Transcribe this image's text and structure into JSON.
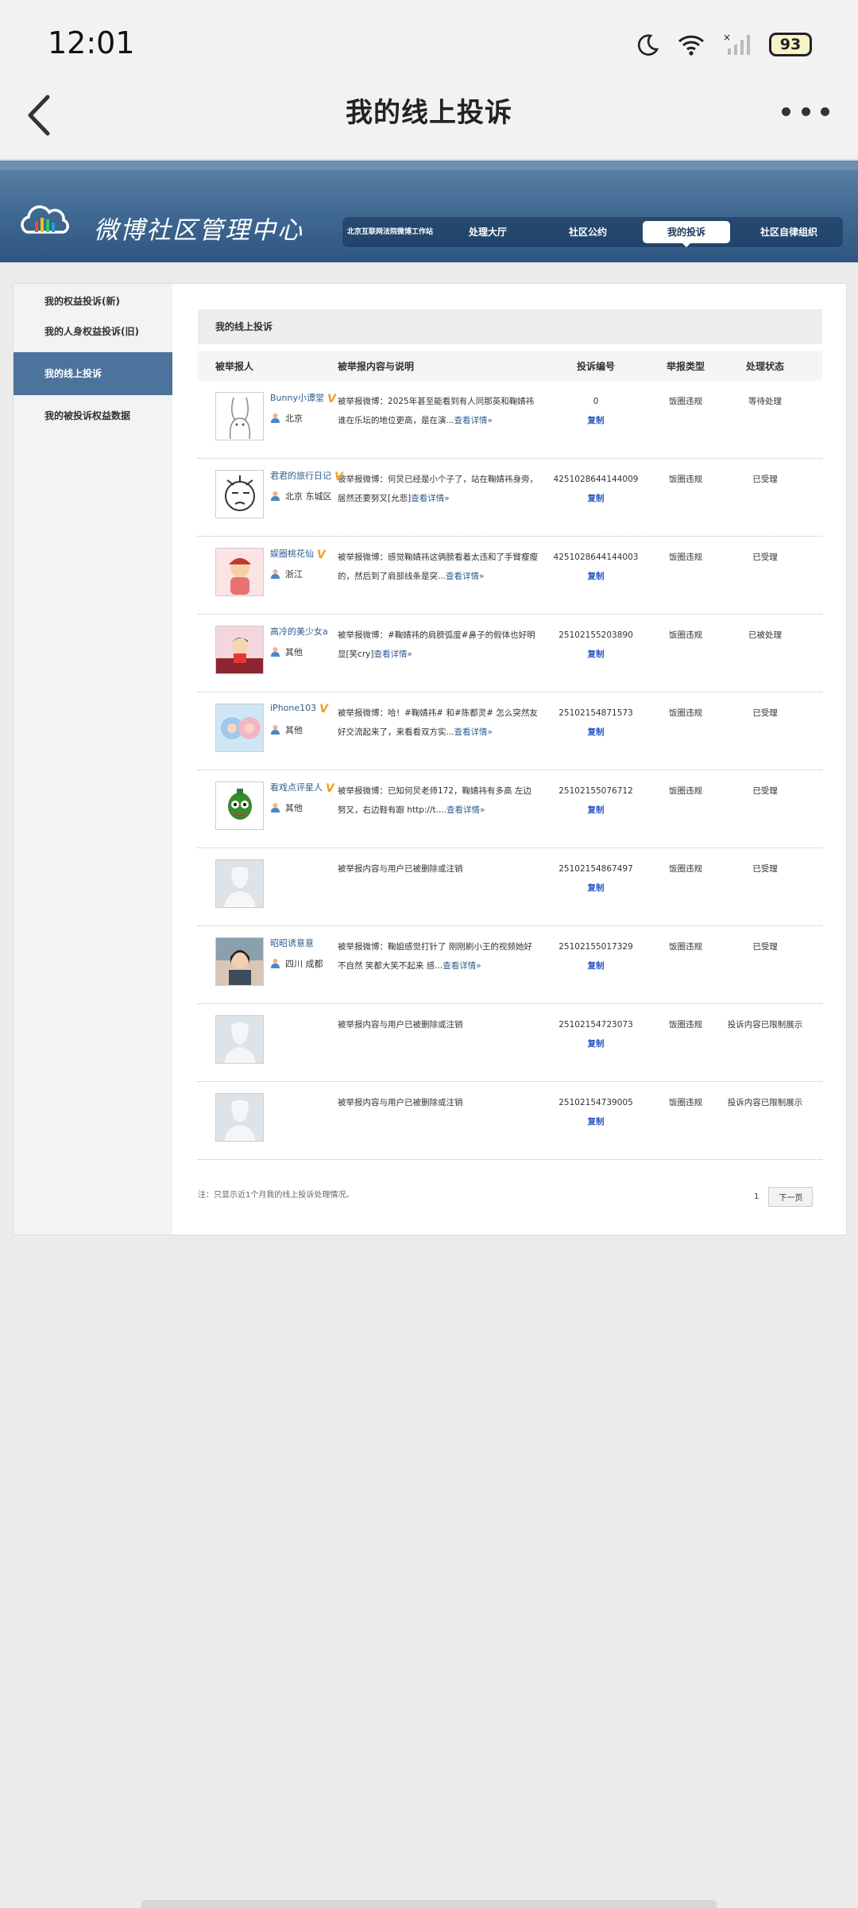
{
  "status_bar": {
    "time": "12:01",
    "battery": "93"
  },
  "nav": {
    "title": "我的线上投诉"
  },
  "header": {
    "logo_text": "微博社区管理中心",
    "nav_items": [
      {
        "label": "北京互联网法院微博工作站"
      },
      {
        "label": "处理大厅"
      },
      {
        "label": "社区公约"
      },
      {
        "label": "我的投诉"
      },
      {
        "label": "社区自律组织"
      }
    ]
  },
  "sidebar": {
    "items": [
      {
        "label": "我的权益投诉(新)"
      },
      {
        "label": "我的人身权益投诉(旧)"
      },
      {
        "label": "我的线上投诉"
      },
      {
        "label": "我的被投诉权益数据"
      }
    ]
  },
  "content": {
    "title": "我的线上投诉",
    "columns": [
      "被举报人",
      "被举报内容与说明",
      "投诉编号",
      "举报类型",
      "处理状态"
    ],
    "copy_label": "复制",
    "rows": [
      {
        "user": "Bunny小谭堂",
        "verified": true,
        "location": "北京",
        "desc": "被举报微博：2025年甚至能看到有人同那英和鞠婧祎谁在乐坛的地位更高，是在演...",
        "more": "查看详情»",
        "id": "0",
        "type": "饭圈违规",
        "status": "等待处理"
      },
      {
        "user": "君君的旅行日记",
        "verified": true,
        "location": "北京 东城区",
        "desc": "被举报微博：何炅已经是小个子了，站在鞠婧祎身旁，居然还要努叉[允悲]",
        "more": "查看详情»",
        "id": "4251028644144009",
        "type": "饭圈违规",
        "status": "已受理"
      },
      {
        "user": "娱圈桃花仙",
        "verified": true,
        "location": "浙江",
        "desc": "被举报微博：感觉鞠婧祎这俩膀看着太违和了手臂瘦瘦的，然后到了肩部线条是突...",
        "more": "查看详情»",
        "id": "4251028644144003",
        "type": "饭圈违规",
        "status": "已受理"
      },
      {
        "user": "高冷的美少女a",
        "verified": false,
        "location": "其他",
        "desc": "被举报微博：#鞠婧祎的肩膀弧度#鼻子的假体也好明显[笑cry]",
        "more": "查看详情»",
        "id": "2510215520389​0",
        "type": "饭圈违规",
        "status": "已被处理"
      },
      {
        "user": "iPhone103",
        "verified": true,
        "location": "其他",
        "desc": "被举报微博：哈！#鞠婧祎# 和#陈都灵# 怎么突然友好交流起来了，来看看双方实...",
        "more": "查看详情»",
        "id": "25102154871573",
        "type": "饭圈违规",
        "status": "已受理"
      },
      {
        "user": "看戏点评星人",
        "verified": true,
        "location": "其他",
        "desc": "被举报微博：已知何炅老师172，鞠婧祎有多高 左边努叉，右边鞋有跟 http://t....",
        "more": "查看详情»",
        "id": "25102155076712",
        "type": "饭圈违规",
        "status": "已受理"
      },
      {
        "user": "",
        "verified": false,
        "location": "",
        "desc": "被举报内容与用户已被删除或注销",
        "more": "",
        "id": "25102154867497",
        "type": "饭圈违规",
        "status": "已受理"
      },
      {
        "user": "昭昭诱意意",
        "verified": false,
        "location": "四川 成都",
        "desc": "被举报微博：鞠姐感觉打针了 刚刚刷小王的视频她好不自然 笑都大笑不起来 感...",
        "more": "查看详情»",
        "id": "25102155017329",
        "type": "饭圈违规",
        "status": "已受理"
      },
      {
        "user": "",
        "verified": false,
        "location": "",
        "desc": "被举报内容与用户已被删除或注销",
        "more": "",
        "id": "25102154723073",
        "type": "饭圈违规",
        "status": "投诉内容已限制展示"
      },
      {
        "user": "",
        "verified": false,
        "location": "",
        "desc": "被举报内容与用户已被删除或注销",
        "more": "",
        "id": "25102154739005",
        "type": "饭圈违规",
        "status": "投诉内容已限制展示"
      }
    ],
    "footer_note": "注：只显示近1个月我的线上投诉处理情况。",
    "pager": {
      "current": "1",
      "next": "下一页"
    }
  },
  "colors": {
    "header_blue": "#3e6791",
    "sidebar_active": "#4b739c",
    "link": "#2d5d8e",
    "copy": "#2a56c4",
    "vip_badge": "#f0a020"
  }
}
